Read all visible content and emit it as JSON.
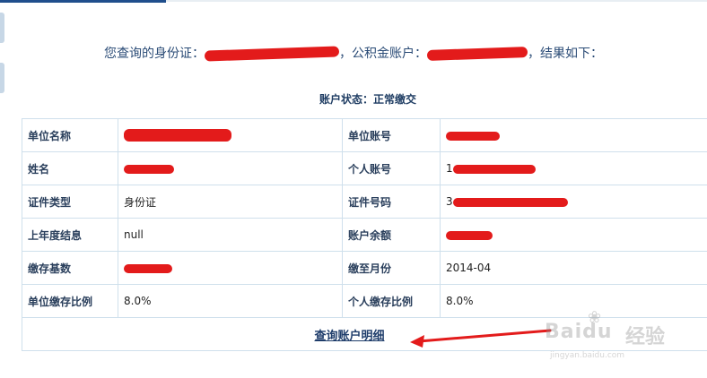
{
  "heading": {
    "prefix": "您查询的身份证：",
    "middle": "，公积金账户：",
    "suffix": "，结果如下："
  },
  "status": {
    "label": "账户状态：正常缴交"
  },
  "table": {
    "rows": [
      {
        "l1": "单位名称",
        "v1": "",
        "l2": "单位账号",
        "v2": ""
      },
      {
        "l1": "姓名",
        "v1": "",
        "l2": "个人账号",
        "v2": "1"
      },
      {
        "l1": "证件类型",
        "v1": "身份证",
        "l2": "证件号码",
        "v2": "3"
      },
      {
        "l1": "上年度结息",
        "v1": "null",
        "l2": "账户余额",
        "v2": ""
      },
      {
        "l1": "缴存基数",
        "v1": "",
        "l2": "缴至月份",
        "v2": "2014-04"
      },
      {
        "l1": "单位缴存比例",
        "v1": "8.0%",
        "l2": "个人缴存比例",
        "v2": "8.0%"
      }
    ]
  },
  "detail_link": "查询账户明细",
  "watermark": {
    "brand": "Baidu",
    "suffix": "经验",
    "url": "jingyan.baidu.com"
  },
  "colors": {
    "redaction": "#e31b1b",
    "heading_text": "#2a4b76",
    "table_border": "#cfe0ec",
    "tab_active": "#1f4e8c"
  }
}
